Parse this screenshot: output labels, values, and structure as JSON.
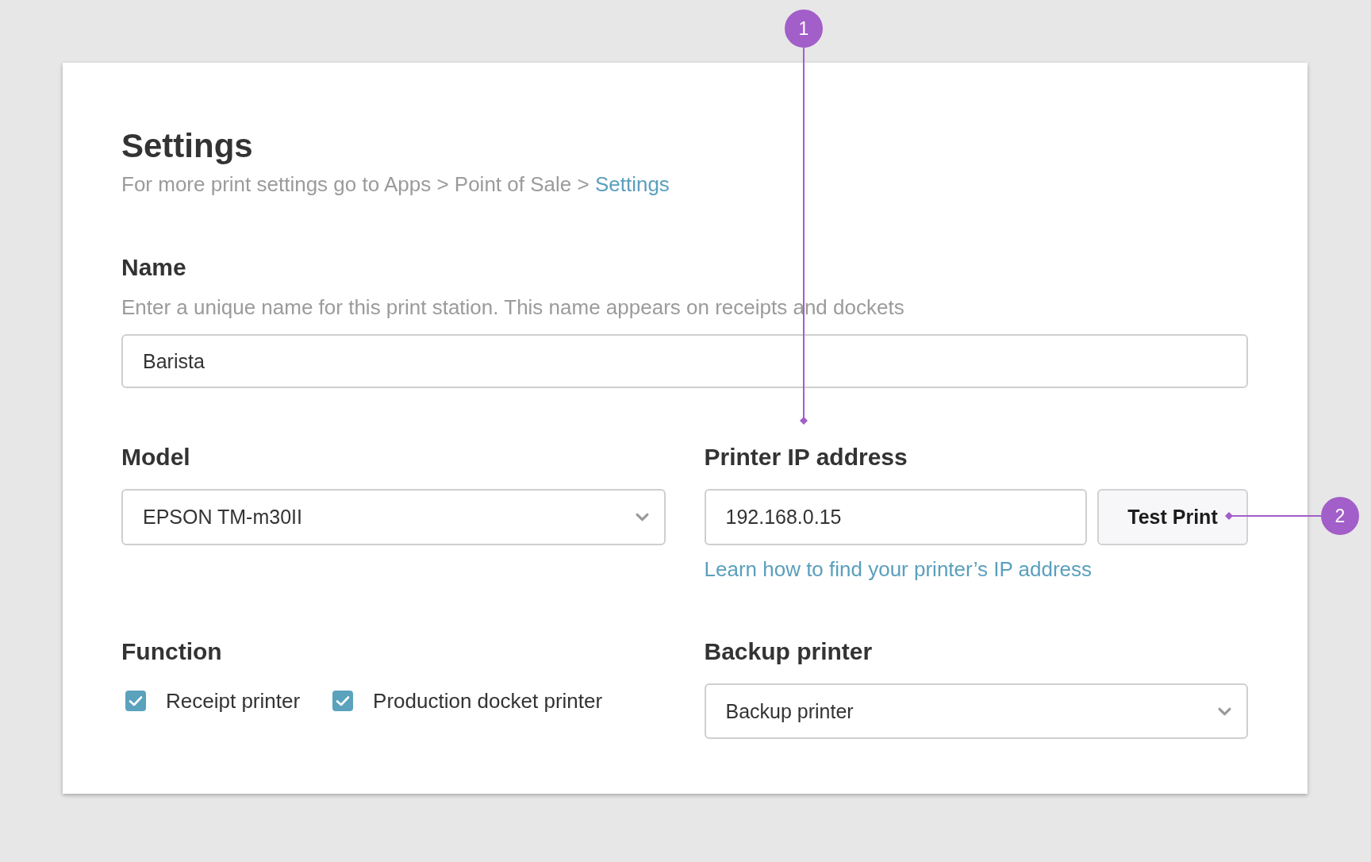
{
  "title": "Settings",
  "subtitle": {
    "text": "For more print settings go to Apps > Point of Sale >",
    "link": "Settings"
  },
  "name_field": {
    "label": "Name",
    "description": "Enter a unique name for this print station. This name appears on receipts and dockets",
    "value": "Barista"
  },
  "model_field": {
    "label": "Model",
    "value": "EPSON TM-m30II"
  },
  "printer_ip_field": {
    "label": "Printer IP address",
    "value": "192.168.0.15",
    "button": "Test Print",
    "help_link": "Learn how to find your printer’s IP address"
  },
  "function_field": {
    "label": "Function",
    "options": [
      {
        "label": "Receipt printer",
        "checked": true
      },
      {
        "label": "Production docket printer",
        "checked": true
      }
    ]
  },
  "backup_printer_field": {
    "label": "Backup printer",
    "value": "Backup printer"
  },
  "annotations": [
    {
      "number": "1"
    },
    {
      "number": "2"
    }
  ]
}
